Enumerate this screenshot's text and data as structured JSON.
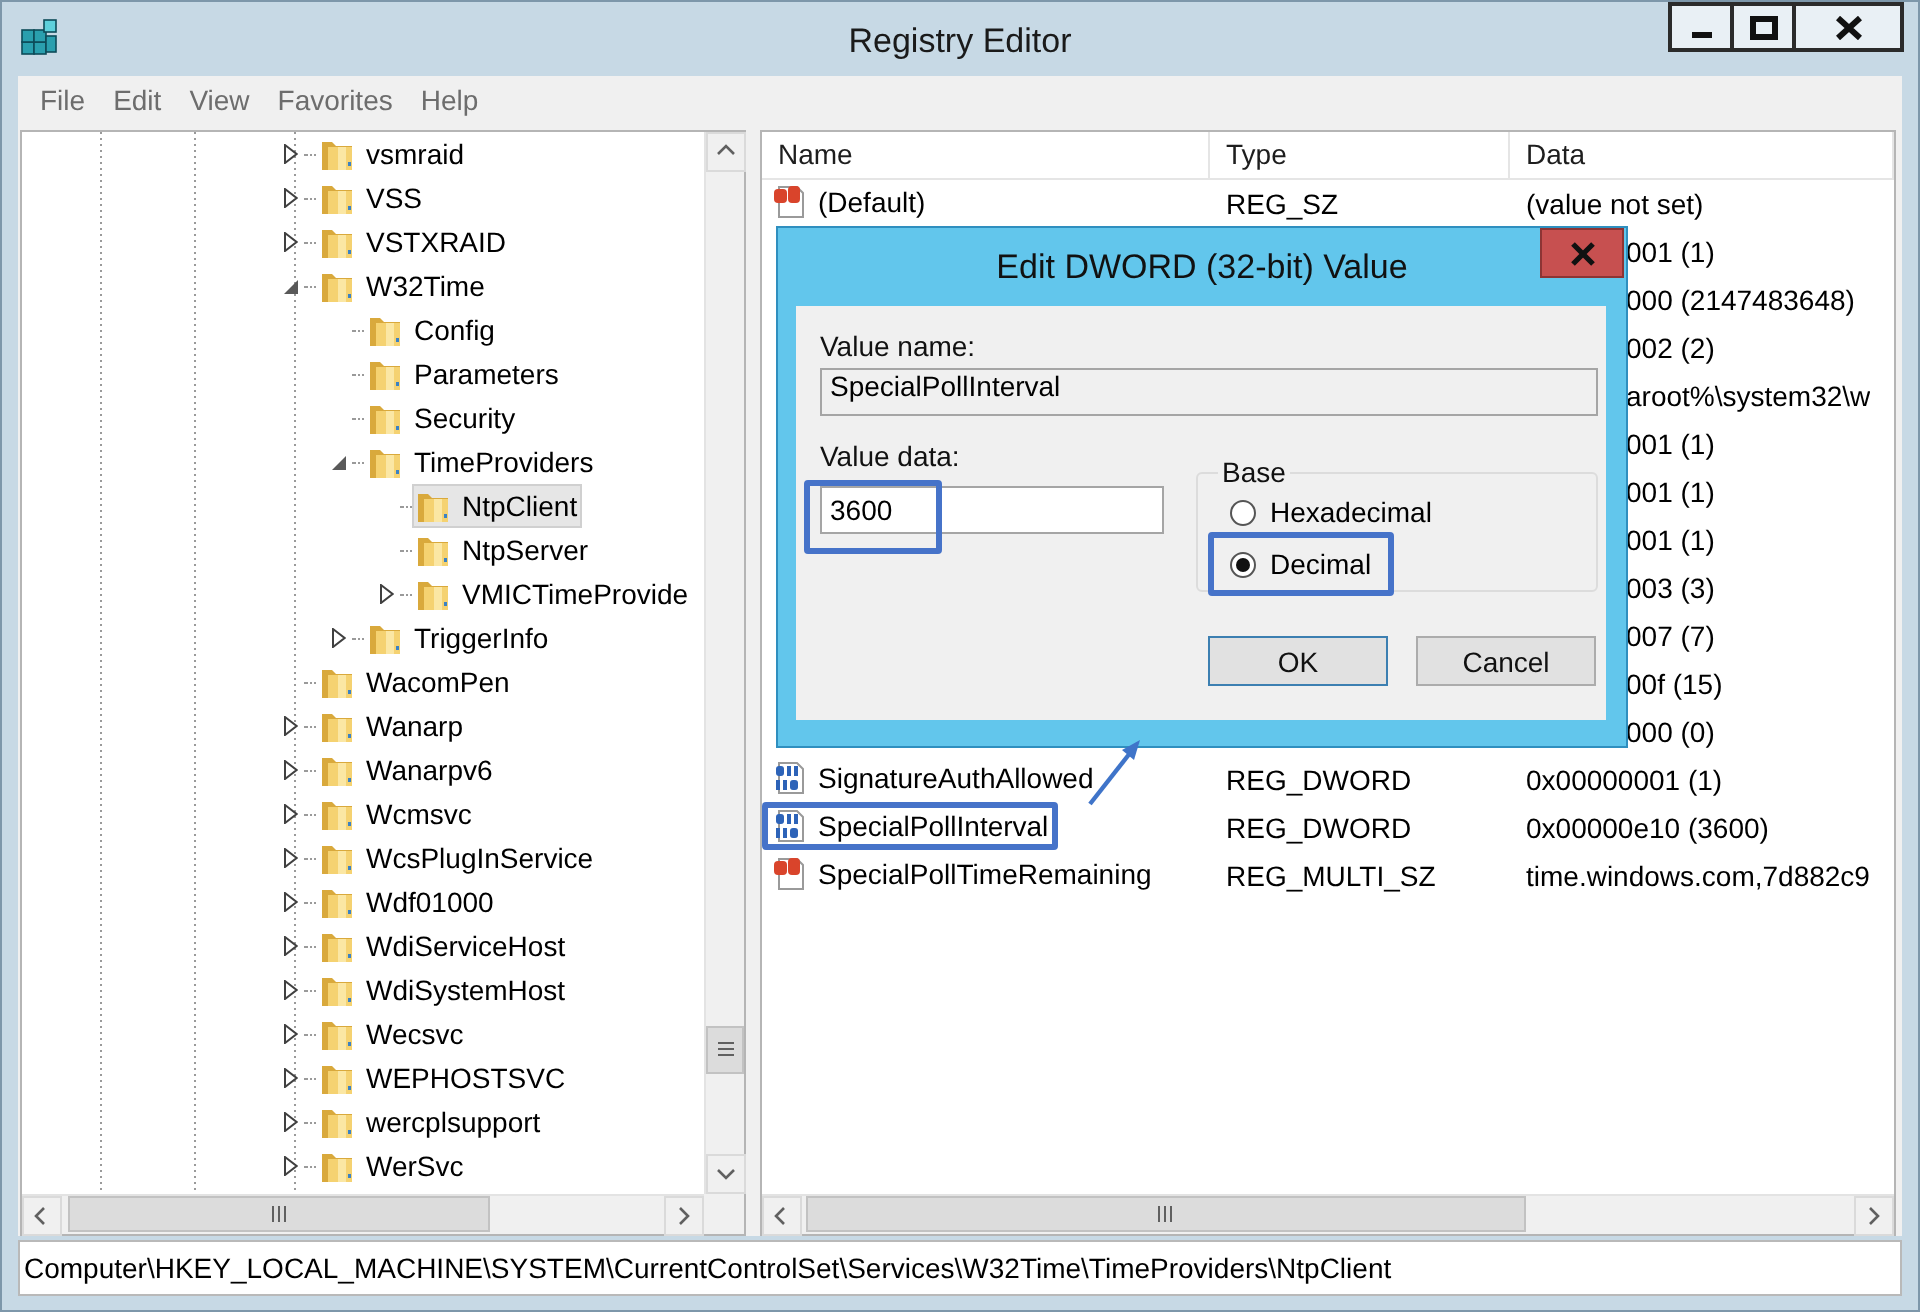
{
  "window": {
    "title": "Registry Editor"
  },
  "menu": [
    "File",
    "Edit",
    "View",
    "Favorites",
    "Help"
  ],
  "tree": {
    "items": [
      {
        "label": "vsmraid",
        "expandable": true,
        "expanded": false,
        "selected": false
      },
      {
        "label": "VSS",
        "expandable": true,
        "expanded": false,
        "selected": false
      },
      {
        "label": "VSTXRAID",
        "expandable": true,
        "expanded": false,
        "selected": false
      },
      {
        "label": "W32Time",
        "expandable": true,
        "expanded": true,
        "selected": false,
        "children": [
          {
            "label": "Config",
            "expandable": false,
            "selected": false
          },
          {
            "label": "Parameters",
            "expandable": false,
            "selected": false
          },
          {
            "label": "Security",
            "expandable": false,
            "selected": false
          },
          {
            "label": "TimeProviders",
            "expandable": true,
            "expanded": true,
            "selected": false,
            "children": [
              {
                "label": "NtpClient",
                "expandable": false,
                "selected": true
              },
              {
                "label": "NtpServer",
                "expandable": false,
                "selected": false
              },
              {
                "label": "VMICTimeProvide",
                "expandable": true,
                "expanded": false,
                "selected": false
              }
            ]
          },
          {
            "label": "TriggerInfo",
            "expandable": true,
            "expanded": false,
            "selected": false
          }
        ]
      },
      {
        "label": "WacomPen",
        "expandable": false,
        "selected": false
      },
      {
        "label": "Wanarp",
        "expandable": true,
        "expanded": false,
        "selected": false
      },
      {
        "label": "Wanarpv6",
        "expandable": true,
        "expanded": false,
        "selected": false
      },
      {
        "label": "Wcmsvc",
        "expandable": true,
        "expanded": false,
        "selected": false
      },
      {
        "label": "WcsPlugInService",
        "expandable": true,
        "expanded": false,
        "selected": false
      },
      {
        "label": "Wdf01000",
        "expandable": true,
        "expanded": false,
        "selected": false
      },
      {
        "label": "WdiServiceHost",
        "expandable": true,
        "expanded": false,
        "selected": false
      },
      {
        "label": "WdiSystemHost",
        "expandable": true,
        "expanded": false,
        "selected": false
      },
      {
        "label": "Wecsvc",
        "expandable": true,
        "expanded": false,
        "selected": false
      },
      {
        "label": "WEPHOSTSVC",
        "expandable": true,
        "expanded": false,
        "selected": false
      },
      {
        "label": "wercplsupport",
        "expandable": true,
        "expanded": false,
        "selected": false
      },
      {
        "label": "WerSvc",
        "expandable": true,
        "expanded": false,
        "selected": false
      }
    ]
  },
  "list": {
    "columns": [
      "Name",
      "Type",
      "Data"
    ],
    "rows": [
      {
        "kind": "string",
        "name": "(Default)",
        "type": "REG_SZ",
        "data": "(value not set)",
        "highlighted": false
      },
      {
        "kind": "covered",
        "data": "001 (1)",
        "highlighted": false
      },
      {
        "kind": "covered",
        "data": "000 (2147483648)",
        "highlighted": false
      },
      {
        "kind": "covered",
        "data": "002 (2)",
        "highlighted": false
      },
      {
        "kind": "covered",
        "data": "aroot%\\system32\\w",
        "highlighted": false
      },
      {
        "kind": "covered",
        "data": "001 (1)",
        "highlighted": false
      },
      {
        "kind": "covered",
        "data": "001 (1)",
        "highlighted": false
      },
      {
        "kind": "covered",
        "data": "001 (1)",
        "highlighted": false
      },
      {
        "kind": "covered",
        "data": "003 (3)",
        "highlighted": false
      },
      {
        "kind": "covered",
        "data": "007 (7)",
        "highlighted": false
      },
      {
        "kind": "covered",
        "data": "00f (15)",
        "highlighted": false
      },
      {
        "kind": "covered",
        "data": "000 (0)",
        "highlighted": false
      },
      {
        "kind": "dword",
        "name": "SignatureAuthAllowed",
        "type": "REG_DWORD",
        "data": "0x00000001 (1)",
        "highlighted": false
      },
      {
        "kind": "dword",
        "name": "SpecialPollInterval",
        "type": "REG_DWORD",
        "data": "0x00000e10 (3600)",
        "highlighted": true
      },
      {
        "kind": "string",
        "name": "SpecialPollTimeRemaining",
        "type": "REG_MULTI_SZ",
        "data": "time.windows.com,7d882c9",
        "highlighted": false
      }
    ]
  },
  "dialog": {
    "title": "Edit DWORD (32-bit) Value",
    "value_name": {
      "label": "Value name:",
      "value": "SpecialPollInterval"
    },
    "value_data": {
      "label": "Value data:",
      "value": "3600",
      "highlighted": true
    },
    "base": {
      "label": "Base",
      "options": [
        {
          "label": "Hexadecimal",
          "selected": false,
          "highlighted": false
        },
        {
          "label": "Decimal",
          "selected": true,
          "highlighted": true
        }
      ]
    },
    "buttons": [
      {
        "label": "OK",
        "default": true
      },
      {
        "label": "Cancel",
        "default": false
      }
    ]
  },
  "status_bar": {
    "path": "Computer\\HKEY_LOCAL_MACHINE\\SYSTEM\\CurrentControlSet\\Services\\W32Time\\TimeProviders\\NtpClient"
  }
}
